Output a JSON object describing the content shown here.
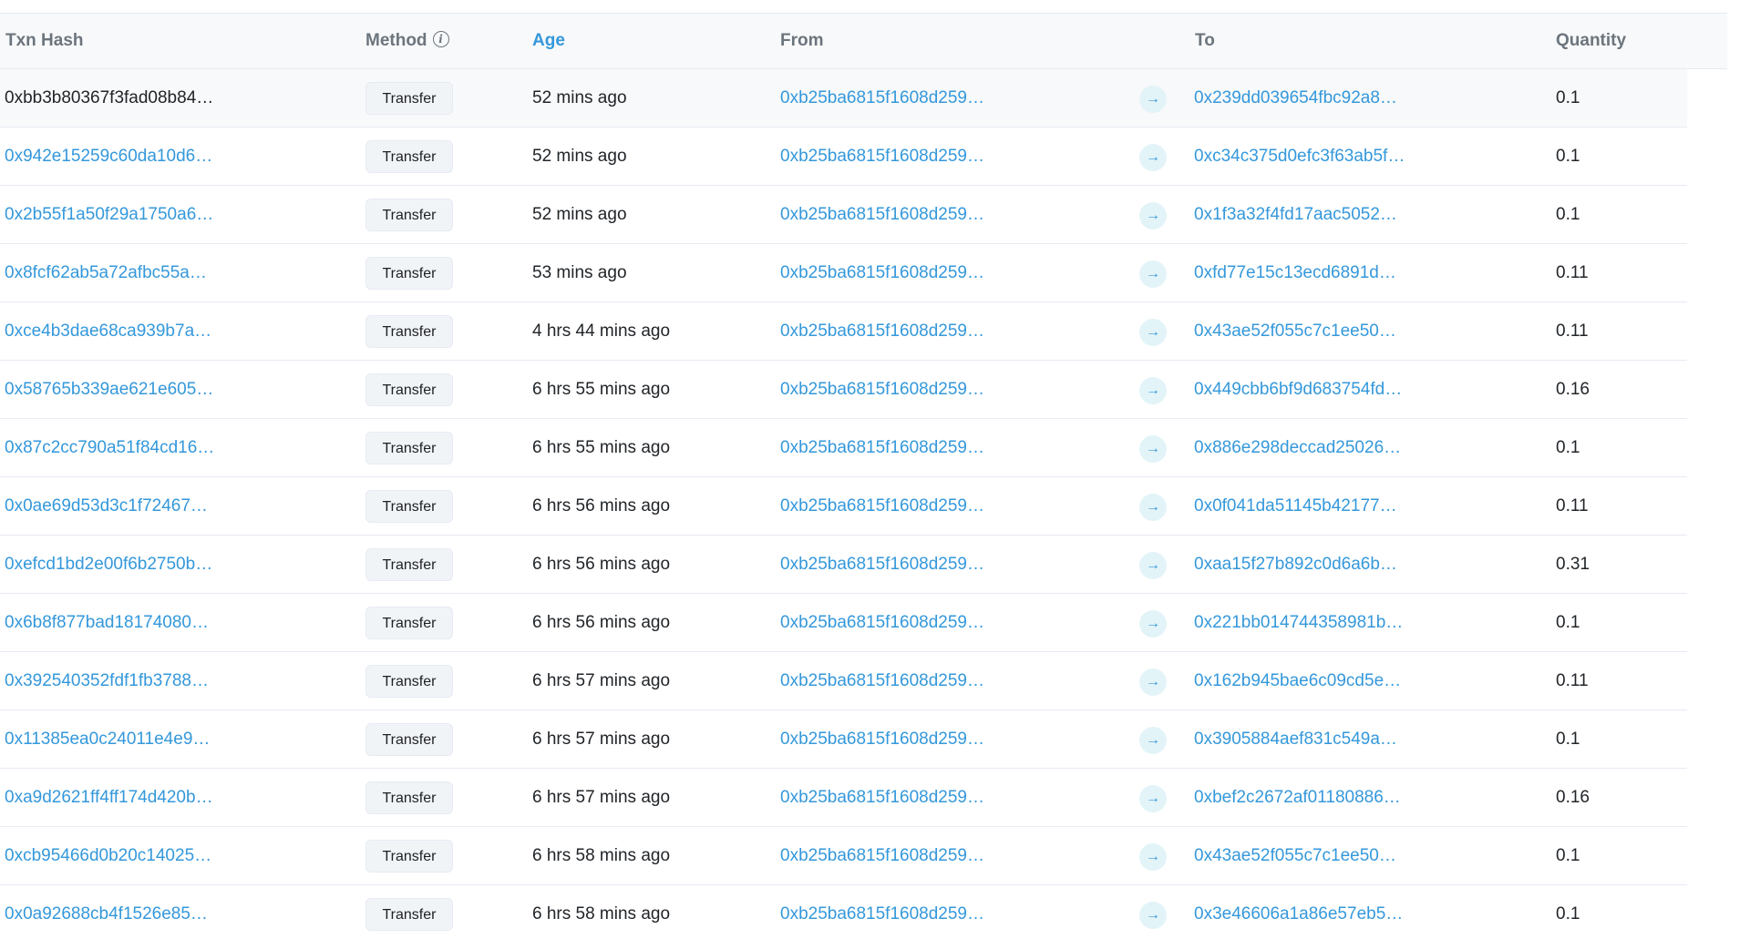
{
  "table": {
    "headers": {
      "txn_hash": "Txn Hash",
      "method": "Method",
      "age": "Age",
      "from": "From",
      "to": "To",
      "quantity": "Quantity"
    },
    "icons": {
      "method_info": "info-icon",
      "direction": "arrow-right-icon"
    },
    "rows": [
      {
        "hash": "0xbb3b80367f3fad08b84…",
        "method": "Transfer",
        "age": "52 mins ago",
        "from": "0xb25ba6815f1608d259…",
        "arrow": "→",
        "to": "0x239dd039654fbc92a8…",
        "quantity": "0.1"
      },
      {
        "hash": "0x942e15259c60da10d6…",
        "method": "Transfer",
        "age": "52 mins ago",
        "from": "0xb25ba6815f1608d259…",
        "arrow": "→",
        "to": "0xc34c375d0efc3f63ab5f…",
        "quantity": "0.1"
      },
      {
        "hash": "0x2b55f1a50f29a1750a6…",
        "method": "Transfer",
        "age": "52 mins ago",
        "from": "0xb25ba6815f1608d259…",
        "arrow": "→",
        "to": "0x1f3a32f4fd17aac5052…",
        "quantity": "0.1"
      },
      {
        "hash": "0x8fcf62ab5a72afbc55a…",
        "method": "Transfer",
        "age": "53 mins ago",
        "from": "0xb25ba6815f1608d259…",
        "arrow": "→",
        "to": "0xfd77e15c13ecd6891d…",
        "quantity": "0.11"
      },
      {
        "hash": "0xce4b3dae68ca939b7a…",
        "method": "Transfer",
        "age": "4 hrs 44 mins ago",
        "from": "0xb25ba6815f1608d259…",
        "arrow": "→",
        "to": "0x43ae52f055c7c1ee50…",
        "quantity": "0.11"
      },
      {
        "hash": "0x58765b339ae621e605…",
        "method": "Transfer",
        "age": "6 hrs 55 mins ago",
        "from": "0xb25ba6815f1608d259…",
        "arrow": "→",
        "to": "0x449cbb6bf9d683754fd…",
        "quantity": "0.16"
      },
      {
        "hash": "0x87c2cc790a51f84cd16…",
        "method": "Transfer",
        "age": "6 hrs 55 mins ago",
        "from": "0xb25ba6815f1608d259…",
        "arrow": "→",
        "to": "0x886e298deccad25026…",
        "quantity": "0.1"
      },
      {
        "hash": "0x0ae69d53d3c1f72467…",
        "method": "Transfer",
        "age": "6 hrs 56 mins ago",
        "from": "0xb25ba6815f1608d259…",
        "arrow": "→",
        "to": "0x0f041da51145b42177…",
        "quantity": "0.11"
      },
      {
        "hash": "0xefcd1bd2e00f6b2750b…",
        "method": "Transfer",
        "age": "6 hrs 56 mins ago",
        "from": "0xb25ba6815f1608d259…",
        "arrow": "→",
        "to": "0xaa15f27b892c0d6a6b…",
        "quantity": "0.31"
      },
      {
        "hash": "0x6b8f877bad18174080…",
        "method": "Transfer",
        "age": "6 hrs 56 mins ago",
        "from": "0xb25ba6815f1608d259…",
        "arrow": "→",
        "to": "0x221bb014744358981b…",
        "quantity": "0.1"
      },
      {
        "hash": "0x392540352fdf1fb3788…",
        "method": "Transfer",
        "age": "6 hrs 57 mins ago",
        "from": "0xb25ba6815f1608d259…",
        "arrow": "→",
        "to": "0x162b945bae6c09cd5e…",
        "quantity": "0.11"
      },
      {
        "hash": "0x11385ea0c24011e4e9…",
        "method": "Transfer",
        "age": "6 hrs 57 mins ago",
        "from": "0xb25ba6815f1608d259…",
        "arrow": "→",
        "to": "0x3905884aef831c549a…",
        "quantity": "0.1"
      },
      {
        "hash": "0xa9d2621ff4ff174d420b…",
        "method": "Transfer",
        "age": "6 hrs 57 mins ago",
        "from": "0xb25ba6815f1608d259…",
        "arrow": "→",
        "to": "0xbef2c2672af01180886…",
        "quantity": "0.16"
      },
      {
        "hash": "0xcb95466d0b20c14025…",
        "method": "Transfer",
        "age": "6 hrs 58 mins ago",
        "from": "0xb25ba6815f1608d259…",
        "arrow": "→",
        "to": "0x43ae52f055c7c1ee50…",
        "quantity": "0.1"
      },
      {
        "hash": "0x0a92688cb4f1526e85…",
        "method": "Transfer",
        "age": "6 hrs 58 mins ago",
        "from": "0xb25ba6815f1608d259…",
        "arrow": "→",
        "to": "0x3e46606a1a86e57eb5…",
        "quantity": "0.1"
      }
    ]
  }
}
